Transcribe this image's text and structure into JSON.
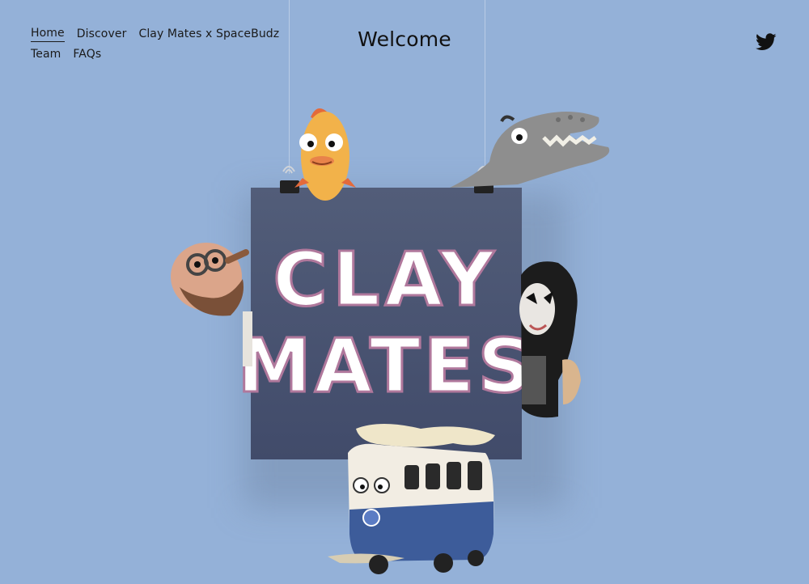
{
  "nav": {
    "items": [
      {
        "label": "Home",
        "active": true
      },
      {
        "label": "Discover"
      },
      {
        "label": "Clay Mates x SpaceBudz"
      },
      {
        "label": "Team"
      },
      {
        "label": "FAQs"
      }
    ]
  },
  "page": {
    "title": "Welcome"
  },
  "hero": {
    "board_text_line1": "CLAY",
    "board_text_line2": "MATES"
  },
  "social": {
    "icon": "twitter-icon"
  },
  "colors": {
    "background": "#94b1d8",
    "board": "#4a5472",
    "board_text_fill": "#ffffff",
    "board_text_outline": "#b0789c"
  }
}
